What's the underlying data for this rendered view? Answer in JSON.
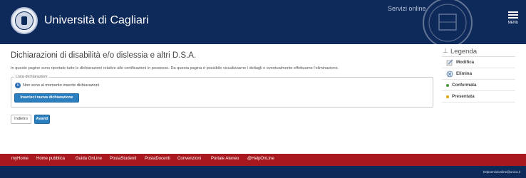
{
  "header": {
    "brand": "Università di Cagliari",
    "servizi": "Servizi online",
    "menu_label": "MENU",
    "bg_color": "#0e2a5a"
  },
  "main": {
    "title": "Dichiarazioni di disabilità e/o dislessia e altri D.S.A.",
    "intro": "In queste pagine sono riportate tutte le dichiarazioni relative alle certificazioni in possesso. Da questa pagina è possibile visualizzarne i dettagli e eventualmente effettuarne l'eliminazione.",
    "list_legend": "Lista dichiarazioni",
    "info_text": "Non sono al momento inserite dichiarazioni",
    "add_button": "Inserisci nuova dichiarazione",
    "back_button": "Indietro",
    "next_button": "Avanti",
    "accent": "#2c7fbf"
  },
  "legend": {
    "title": "Legenda",
    "items": [
      {
        "label": "Modifica",
        "icon": "edit-icon"
      },
      {
        "label": "Elimina",
        "icon": "delete-icon"
      },
      {
        "label": "Confermata",
        "color": "#4a9a3a"
      },
      {
        "label": "Presentata",
        "color": "#d9a400"
      }
    ]
  },
  "footer": {
    "links": [
      "myHome",
      "Home pubblica",
      "Guida OnLine",
      "PostaStudenti",
      "PostaDocenti",
      "Convenzioni",
      "Portale Ateneo",
      "@HelpOnLine"
    ],
    "email": "helpservizionline@unica.it",
    "bg_color": "#a8191f"
  }
}
